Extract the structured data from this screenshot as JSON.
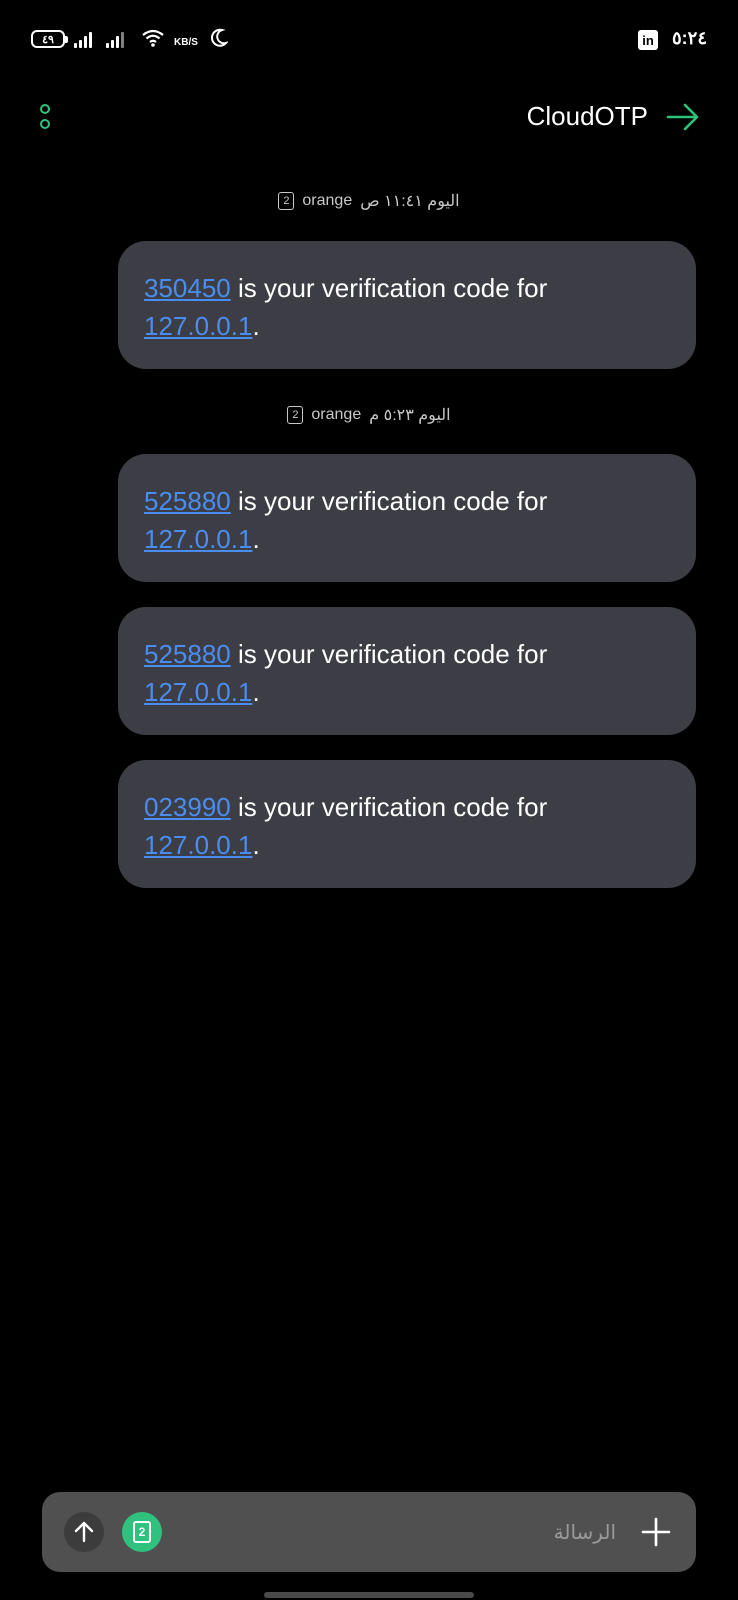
{
  "status": {
    "battery": "٤٩",
    "network_speed": "KB/S",
    "time": "٥:٢٤",
    "notification_app": "in"
  },
  "header": {
    "title": "CloudOTP",
    "accent_color": "#2ec27e"
  },
  "conversation": {
    "groups": [
      {
        "date_label": "اليوم ١١:٤١ ص",
        "carrier": "orange",
        "sim": "2",
        "messages": [
          {
            "code": "350450",
            "text": " is your verification code for ",
            "host": "127.0.0.1",
            "suffix": "."
          }
        ]
      },
      {
        "date_label": "اليوم ٥:٢٣ م",
        "carrier": "orange",
        "sim": "2",
        "messages": [
          {
            "code": "525880",
            "text": " is your verification code for ",
            "host": "127.0.0.1",
            "suffix": "."
          },
          {
            "code": "525880",
            "text": " is your verification code for ",
            "host": "127.0.0.1",
            "suffix": "."
          },
          {
            "code": "023990",
            "text": " is your verification code for ",
            "host": "127.0.0.1",
            "suffix": "."
          }
        ]
      }
    ]
  },
  "composer": {
    "placeholder": "الرسالة",
    "sim": "2"
  }
}
